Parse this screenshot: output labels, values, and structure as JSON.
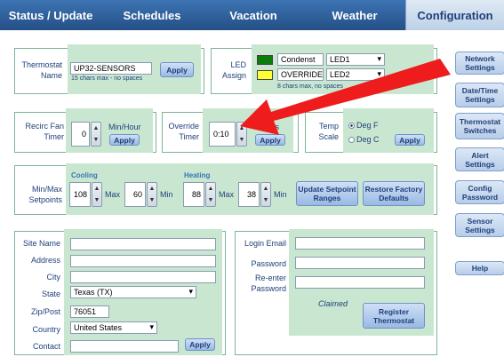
{
  "tabs": [
    "Status / Update",
    "Schedules",
    "Vacation",
    "Weather",
    "Configuration"
  ],
  "thermostat": {
    "label": "Thermostat Name",
    "name": "UP32-SENSORS",
    "hint": "15 chars max - no spaces",
    "apply": "Apply"
  },
  "led": {
    "label": "LED Assign",
    "rows": [
      {
        "name": "Condenst",
        "value": "LED1"
      },
      {
        "name": "OVERRIDE",
        "value": "LED2"
      }
    ],
    "hint": "8 chars max, no spaces"
  },
  "recirc": {
    "label": "Recirc Fan Timer",
    "value": "0",
    "unit": "Min/Hour",
    "apply": "Apply"
  },
  "override": {
    "label": "Override Timer",
    "value": "0:10",
    "unit": "Hours",
    "apply": "Apply"
  },
  "temp": {
    "label": "Temp Scale",
    "opt_f": "Deg F",
    "opt_c": "Deg C",
    "apply": "Apply"
  },
  "setpoints": {
    "label": "Min/Max Setpoints",
    "cooling": "Cooling",
    "heating": "Heating",
    "cool_max": "108",
    "cool_min": "60",
    "heat_max": "88",
    "heat_min": "38",
    "max": "Max",
    "min": "Min",
    "update": "Update Setpoint Ranges",
    "restore": "Restore Factory Defaults"
  },
  "site": {
    "site_name": "Site Name",
    "address": "Address",
    "city": "City",
    "state": "State",
    "state_val": "Texas (TX)",
    "zip": "Zip/Post",
    "zip_val": "76051",
    "country": "Country",
    "country_val": "United States",
    "contact": "Contact",
    "apply": "Apply"
  },
  "login": {
    "email": "Login Email",
    "password": "Password",
    "reenter": "Re-enter Password",
    "claimed": "Claimed",
    "register": "Register Thermostat"
  },
  "sidebar": [
    "Network Settings",
    "Date/Time Settings",
    "Thermostat Switches",
    "Alert Settings",
    "Config Password",
    "Sensor Settings",
    "Help"
  ],
  "colors": {
    "accent": "#244f86",
    "panel": "#c9e7d0",
    "arrow": "#ee1c1c",
    "led1": "#0a7d0a",
    "led2": "#ffff33"
  }
}
